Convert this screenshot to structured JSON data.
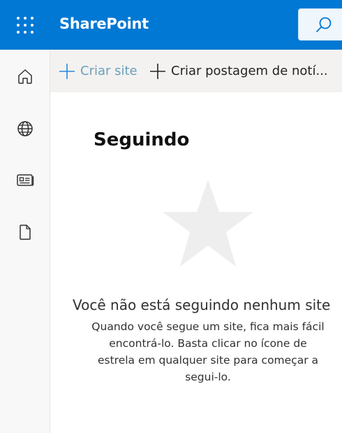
{
  "header": {
    "app_name": "SharePoint",
    "brand_color": "#0078d4",
    "waffle_icon": "app-launcher-icon",
    "search_icon": "search-icon"
  },
  "left_rail": {
    "items": [
      {
        "name": "home",
        "icon": "home-icon"
      },
      {
        "name": "sites",
        "icon": "globe-icon"
      },
      {
        "name": "news",
        "icon": "news-icon"
      },
      {
        "name": "files",
        "icon": "document-icon"
      }
    ]
  },
  "command_bar": {
    "create_site": "Criar site",
    "create_news": "Criar postagem de notí..."
  },
  "main": {
    "heading": "Seguindo",
    "empty_title": "Você não está seguindo nenhum site",
    "empty_description": "Quando você segue um site, fica mais fácil encontrá-lo. Basta clicar no ícone de estrela em qualquer site para começar a segui-lo."
  }
}
